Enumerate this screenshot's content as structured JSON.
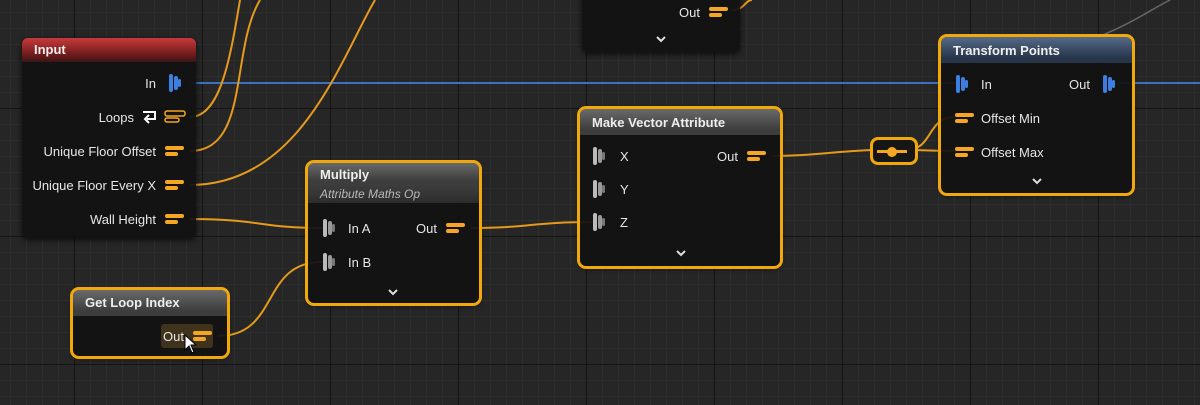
{
  "nodes": {
    "input": {
      "title": "Input",
      "pins": {
        "in": "In",
        "loops": "Loops",
        "unique_floor_offset": "Unique Floor Offset",
        "unique_floor_every_x": "Unique Floor Every X",
        "wall_height": "Wall Height"
      }
    },
    "top_node": {
      "out": "Out"
    },
    "multiply": {
      "title": "Multiply",
      "subtitle": "Attribute Maths Op",
      "in_a": "In A",
      "in_b": "In B",
      "out": "Out"
    },
    "get_loop_index": {
      "title": "Get Loop Index",
      "out": "Out"
    },
    "make_vector": {
      "title": "Make Vector Attribute",
      "x": "X",
      "y": "Y",
      "z": "Z",
      "out": "Out"
    },
    "transform_points": {
      "title": "Transform Points",
      "in": "In",
      "out": "Out",
      "offset_min": "Offset Min",
      "offset_max": "Offset Max"
    }
  },
  "colors": {
    "selection": "#f1a80c",
    "attribute_pin": "#f5a623",
    "point_pin": "#3d7fe0",
    "wire": "#e59a1c",
    "exec_wire": "#3f70c0"
  },
  "icons": [
    "attribute-pin-icon",
    "point-data-pin-icon",
    "loop-pin-icon",
    "expand-chevron-icon",
    "reroute-knot-icon",
    "mouse-cursor-icon"
  ]
}
